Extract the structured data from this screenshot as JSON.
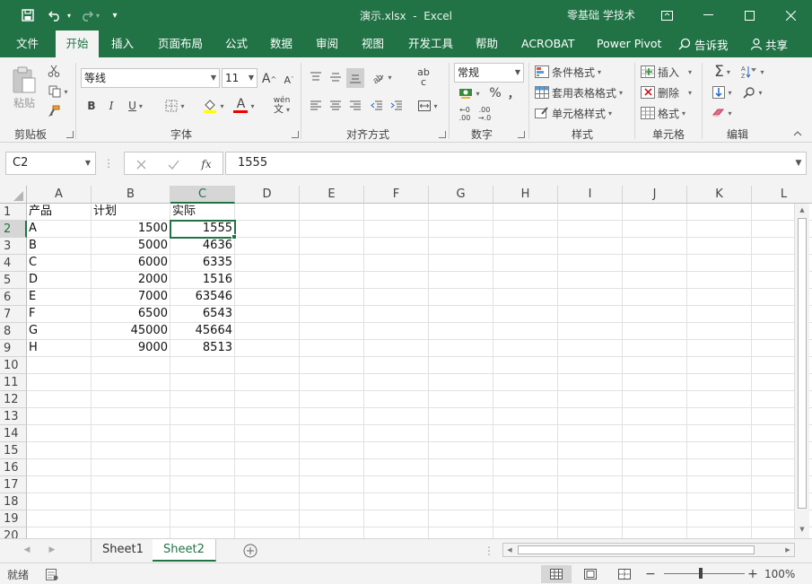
{
  "titlebar": {
    "filename": "演示.xlsx",
    "separator": "-",
    "app": "Excel",
    "user": "零基础 学技术",
    "qa_more": "▾"
  },
  "tabs": {
    "items": [
      "文件",
      "开始",
      "插入",
      "页面布局",
      "公式",
      "数据",
      "审阅",
      "视图",
      "开发工具",
      "帮助",
      "ACROBAT",
      "Power Pivot"
    ],
    "active": "开始",
    "tell_me": "告诉我",
    "share": "共享"
  },
  "ribbon": {
    "clipboard": {
      "paste_label": "粘贴",
      "group_label": "剪贴板"
    },
    "font": {
      "font_name": "等线",
      "font_size": "11",
      "grow": "A",
      "shrink": "A",
      "bold": "B",
      "italic": "I",
      "underline": "U",
      "font_color_glyph": "A",
      "phonetic_top": "wén",
      "phonetic_bottom": "文",
      "group_label": "字体"
    },
    "alignment": {
      "wrap_top": "ab",
      "wrap_bottom": "c",
      "group_label": "对齐方式"
    },
    "number": {
      "format": "常规",
      "percent": "%",
      "comma": "，",
      "dec_inc_top": "←0",
      "dec_inc_bottom": ".00",
      "dec_dec_top": ".00",
      "dec_dec_bottom": "→.0",
      "group_label": "数字"
    },
    "styles": {
      "conditional": "条件格式",
      "table": "套用表格格式",
      "cell": "单元格样式",
      "group_label": "样式"
    },
    "cells": {
      "insert": "插入",
      "delete": "删除",
      "format": "格式",
      "group_label": "单元格"
    },
    "editing": {
      "sum": "Σ",
      "sort": "A/Z",
      "group_label": "编辑"
    }
  },
  "formula_bar": {
    "name_box": "C2",
    "fx": "fx",
    "value": "1555"
  },
  "grid": {
    "columns": [
      "A",
      "B",
      "C",
      "D",
      "E",
      "F",
      "G",
      "H",
      "I",
      "J",
      "K",
      "L"
    ],
    "row_numbers": [
      "1",
      "2",
      "3",
      "4",
      "5",
      "6",
      "7",
      "8",
      "9",
      "10",
      "11",
      "12",
      "13",
      "14",
      "15",
      "16",
      "17",
      "18",
      "19",
      "20"
    ],
    "rows": [
      [
        "产品",
        "计划",
        "实际"
      ],
      [
        "A",
        "1500",
        "1555"
      ],
      [
        "B",
        "5000",
        "4636"
      ],
      [
        "C",
        "6000",
        "6335"
      ],
      [
        "D",
        "2000",
        "1516"
      ],
      [
        "E",
        "7000",
        "63546"
      ],
      [
        "F",
        "6500",
        "6543"
      ],
      [
        "G",
        "45000",
        "45664"
      ],
      [
        "H",
        "9000",
        "8513"
      ]
    ]
  },
  "sheets": {
    "tabs": [
      "Sheet1",
      "Sheet2"
    ],
    "active": "Sheet2"
  },
  "status": {
    "ready": "就绪",
    "zoom": "100%"
  },
  "colors": {
    "accent": "#217346",
    "ribbon_bg": "#f3f3f3"
  }
}
